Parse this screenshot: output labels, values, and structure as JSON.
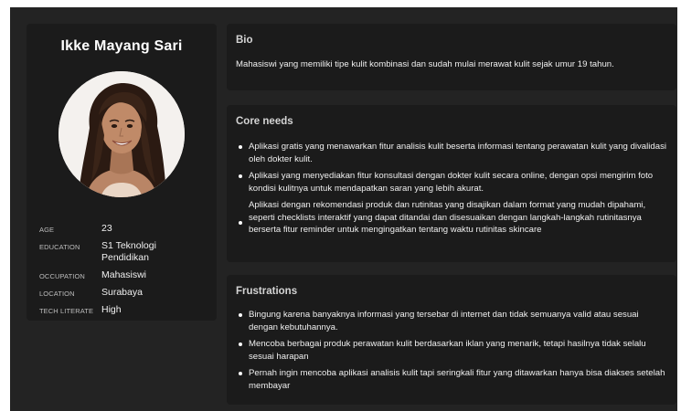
{
  "profile": {
    "name": "Ikke Mayang Sari",
    "attributes": [
      {
        "key": "AGE",
        "value": "23"
      },
      {
        "key": "EDUCATION",
        "value": "S1 Teknologi Pendidikan"
      },
      {
        "key": "OCCUPATION",
        "value": "Mahasiswi"
      },
      {
        "key": "LOCATION",
        "value": "Surabaya"
      },
      {
        "key": "TECH LITERATE",
        "value": "High"
      }
    ]
  },
  "bio": {
    "title": "Bio",
    "text": "Mahasiswi yang  memiliki tipe kulit kombinasi dan sudah mulai merawat kulit sejak umur 19 tahun."
  },
  "core_needs": {
    "title": "Core needs",
    "items": [
      "Aplikasi gratis yang menawarkan fitur analisis kulit beserta informasi tentang perawatan kulit yang divalidasi oleh dokter kulit.",
      " Aplikasi yang menyediakan fitur konsultasi dengan dokter kulit secara online, dengan opsi mengirim foto kondisi kulitnya untuk mendapatkan saran yang lebih akurat.",
      "Aplikasi dengan rekomendasi produk dan rutinitas yang disajikan dalam format yang mudah dipahami, seperti checklists interaktif yang dapat ditandai dan disesuaikan dengan langkah-langkah rutinitasnya berserta fitur reminder untuk mengingatkan tentang waktu rutinitas skincare"
    ]
  },
  "frustrations": {
    "title": "Frustrations",
    "items": [
      "Bingung karena banyaknya informasi yang tersebar di internet dan tidak semuanya valid atau sesuai dengan kebutuhannya.",
      "Mencoba berbagai produk perawatan kulit berdasarkan iklan yang menarik, tetapi hasilnya tidak selalu sesuai harapan",
      "Pernah ingin mencoba aplikasi analisis kulit tapi seringkali fitur yang ditawarkan hanya bisa diakses setelah membayar"
    ]
  },
  "colors": {
    "background": "#232323",
    "card": "#1b1b1b",
    "text": "#efefef",
    "muted": "#bdbdbd"
  },
  "icons": [
    "avatar-photo"
  ]
}
